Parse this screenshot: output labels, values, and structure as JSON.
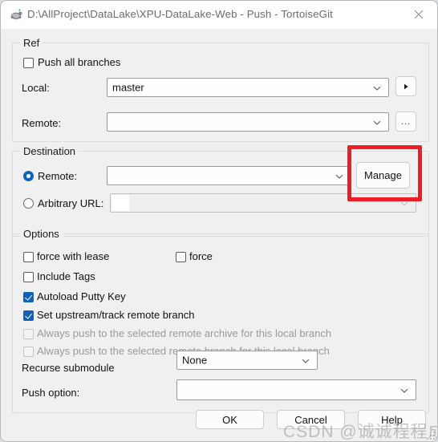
{
  "window": {
    "title": "D:\\AllProject\\DataLake\\XPU-DataLake-Web - Push - TortoiseGit",
    "icon": "tortoisegit-turtle-icon",
    "close_label": "✕"
  },
  "ref_group": {
    "title": "Ref",
    "push_all_branches": {
      "label": "Push all branches",
      "checked": false
    },
    "local": {
      "label": "Local:",
      "value": "master",
      "placeholder": ""
    },
    "local_browse_button": {
      "label": "▶"
    },
    "remote": {
      "label": "Remote:",
      "value": "",
      "placeholder": ""
    },
    "remote_browse_button": {
      "label": "..."
    }
  },
  "destination_group": {
    "title": "Destination",
    "remote_radio": {
      "label": "Remote:",
      "selected": true
    },
    "remote_combo": {
      "value": "",
      "placeholder": ""
    },
    "manage_button": {
      "label": "Manage"
    },
    "arbitrary_radio": {
      "label": "Arbitrary URL:",
      "selected": false
    },
    "arbitrary_combo": {
      "value": "",
      "placeholder": "",
      "disabled": true
    },
    "highlight_color": "#ee1c25"
  },
  "options_group": {
    "title": "Options",
    "checkboxes": [
      {
        "label": "force with lease",
        "checked": false,
        "disabled": false
      },
      {
        "label": "force",
        "checked": false,
        "disabled": false
      },
      {
        "label": "Include Tags",
        "checked": false,
        "disabled": false
      },
      {
        "label": "Autoload Putty Key",
        "checked": true,
        "disabled": false
      },
      {
        "label": "Set upstream/track remote branch",
        "checked": true,
        "disabled": false
      },
      {
        "label": "Always push to the selected remote archive for this local branch",
        "checked": false,
        "disabled": true
      },
      {
        "label": "Always push to the selected remote branch for this local branch",
        "checked": false,
        "disabled": true
      }
    ],
    "recurse_submodule": {
      "label": "Recurse submodule",
      "value": "None"
    },
    "push_option": {
      "label": "Push option:",
      "value": ""
    }
  },
  "footer": {
    "ok_label": "OK",
    "cancel_label": "Cancel",
    "help_label": "Help"
  },
  "watermark": {
    "text": "CSDN @诚诚程程成"
  },
  "theme": {
    "accent": "#0e62b7",
    "dialog_bg": "#f0f0f0",
    "titlebar_bg": "#ffffff",
    "group_border": "#dcdcdc"
  }
}
